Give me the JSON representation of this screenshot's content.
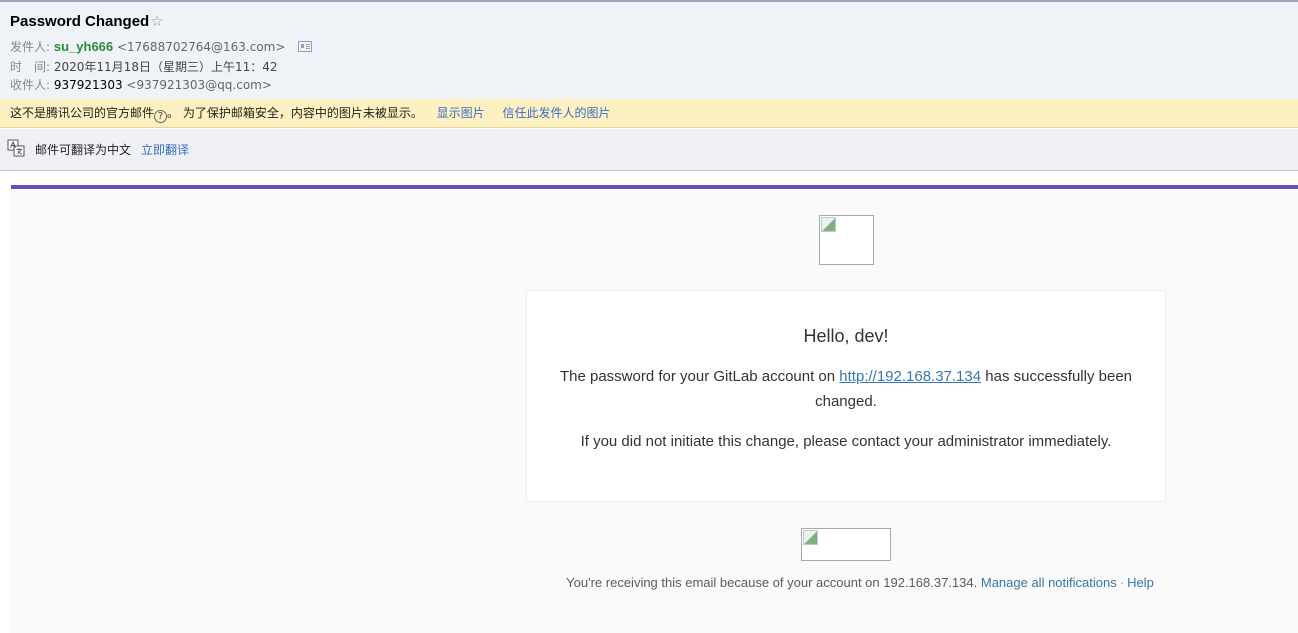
{
  "header": {
    "subject": "Password Changed",
    "star": "☆",
    "from_label": "发件人:",
    "from_name": "su_yh666",
    "from_address": "<17688702764@163.com>",
    "time_label": "时　间:",
    "time_value": "2020年11月18日（星期三）上午11：42",
    "to_label": "收件人:",
    "to_name": "937921303",
    "to_address": "<937921303@qq.com>"
  },
  "warning": {
    "text_before": "这不是腾讯公司的官方邮件",
    "question_mark": "?",
    "text_after": "。 为了保护邮箱安全，内容中的图片未被显示。",
    "show_images": "显示图片",
    "trust_sender": "信任此发件人的图片"
  },
  "translate": {
    "text": "邮件可翻译为中文",
    "link": "立即翻译"
  },
  "email": {
    "greeting": "Hello, dev!",
    "line1_before": "The password for your GitLab account on ",
    "line1_link": "http://192.168.37.134",
    "line1_after": " has successfully been changed.",
    "line2": "If you did not initiate this change, please contact your administrator immediately.",
    "footer_text": "You're receiving this email because of your account on 192.168.37.134.",
    "manage_link": "Manage all notifications",
    "separator": "·",
    "help_link": "Help"
  },
  "colors": {
    "accent_bar": "#6b4fbb",
    "warning_bg": "#fdf1c1",
    "sender_green": "#2d8c3c",
    "link_blue": "#3777b0"
  }
}
